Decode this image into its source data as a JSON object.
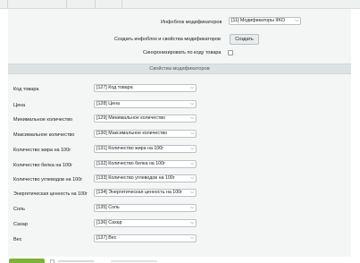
{
  "settings": {
    "infoblock_label": "Инфоблок модификаторов",
    "infoblock_value": "[11] Модификаторы IIKO",
    "create_label": "Создать инфоблок и свойства модификаторов",
    "create_button": "Создать",
    "sync_label": "Синхронизировать по коду товара"
  },
  "section": {
    "title": "Свойства модификаторов"
  },
  "properties": [
    {
      "label": "Код товара",
      "value": "[127] Код товара"
    },
    {
      "label": "Цена",
      "value": "[128] Цена"
    },
    {
      "label": "Минимальное количество",
      "value": "[129] Минимальное количество"
    },
    {
      "label": "Максимальное количество",
      "value": "[130] Максимальное количество"
    },
    {
      "label": "Количество жира на 100г",
      "value": "[131] Количество жира на 100г"
    },
    {
      "label": "Количество белка на 100г",
      "value": "[132] Количество белка на 100г"
    },
    {
      "label": "Количество углеводов на 100г",
      "value": "[133] Количество углеводов на 100г"
    },
    {
      "label": "Энергетическая ценность на 100г",
      "value": "[134] Энергетическая ценность на 100г"
    },
    {
      "label": "Соль",
      "value": "[135] Соль"
    },
    {
      "label": "Сахар",
      "value": "[136] Сахар"
    },
    {
      "label": "Вес",
      "value": "[137] Вес"
    }
  ],
  "icons": {
    "dropdown": "chevron-down-icon",
    "checkbox": "checkbox-icon"
  },
  "colors": {
    "panel_bg": "#f4f6f6",
    "section_header_bg": "#dde3e5",
    "save_button": "#7bb33b"
  }
}
